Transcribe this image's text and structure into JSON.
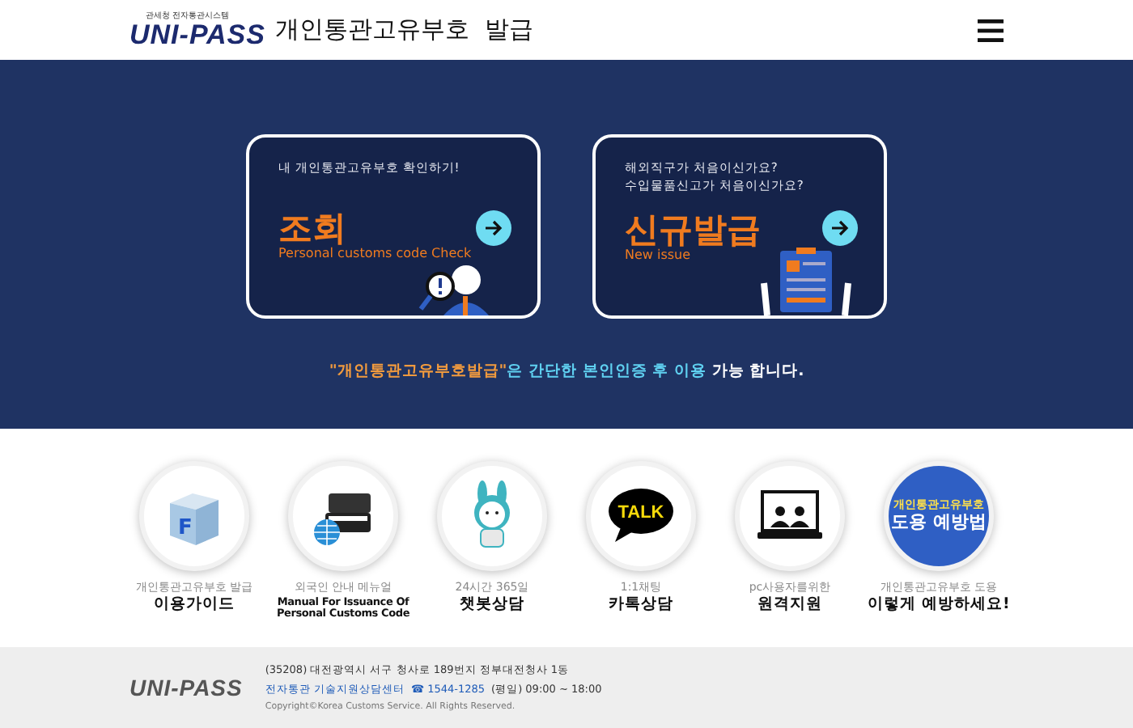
{
  "header": {
    "logo_caption": "관세청 전자통관시스템",
    "logo": "UNI-PASS",
    "title": "개인통관고유부호  발급"
  },
  "hero": {
    "cards": [
      {
        "kind": "lookup",
        "subtitle": [
          "내 개인통관고유부호 확인하기!"
        ],
        "title": "조회",
        "english": "Personal customs code Check"
      },
      {
        "kind": "issue",
        "subtitle": [
          "해외직구가 처음이신가요?",
          "수입물품신고가 처음이신가요?"
        ],
        "title": "신규발급",
        "english": "New issue"
      }
    ],
    "notice": [
      {
        "kind": "highlight",
        "text": "\"개인통관고유부호발급\""
      },
      {
        "kind": "accent",
        "text": "은 간단한 본인인증 후 이용"
      },
      {
        "kind": "plain",
        "text": " 가능 합니다."
      }
    ]
  },
  "services": [
    {
      "kind": "guide",
      "caption": "개인통관고유부호 발급",
      "label": "이용가이드",
      "icon_text": "F"
    },
    {
      "kind": "manual",
      "caption": "외국인 안내 메뉴얼",
      "label": "Manual For Issuance Of Personal Customs Code"
    },
    {
      "kind": "chatbot",
      "caption": "24시간 365일",
      "label": "챗봇상담"
    },
    {
      "kind": "talk",
      "caption": "1:1채팅",
      "label": "카톡상담",
      "icon_text": "TALK"
    },
    {
      "kind": "remote",
      "caption": "pc사용자를위한",
      "label": "원격지원"
    },
    {
      "kind": "prevent",
      "caption": "개인통관고유부호 도용",
      "label": "이렇게 예방하세요!",
      "icon_lines": [
        "개인통관고유부호",
        "도용 예방법"
      ]
    }
  ],
  "footer": {
    "logo": "UNI-PASS",
    "address": "(35208) 대전광역시 서구 청사로 189번지 정부대전청사 1동",
    "center": "전자통관 기술지원상담센터",
    "phone": "☎ 1544-1285",
    "hours": "(평일) 09:00 ~ 18:00",
    "copyright": "Copyright©Korea Customs Service. All Rights Reserved."
  }
}
